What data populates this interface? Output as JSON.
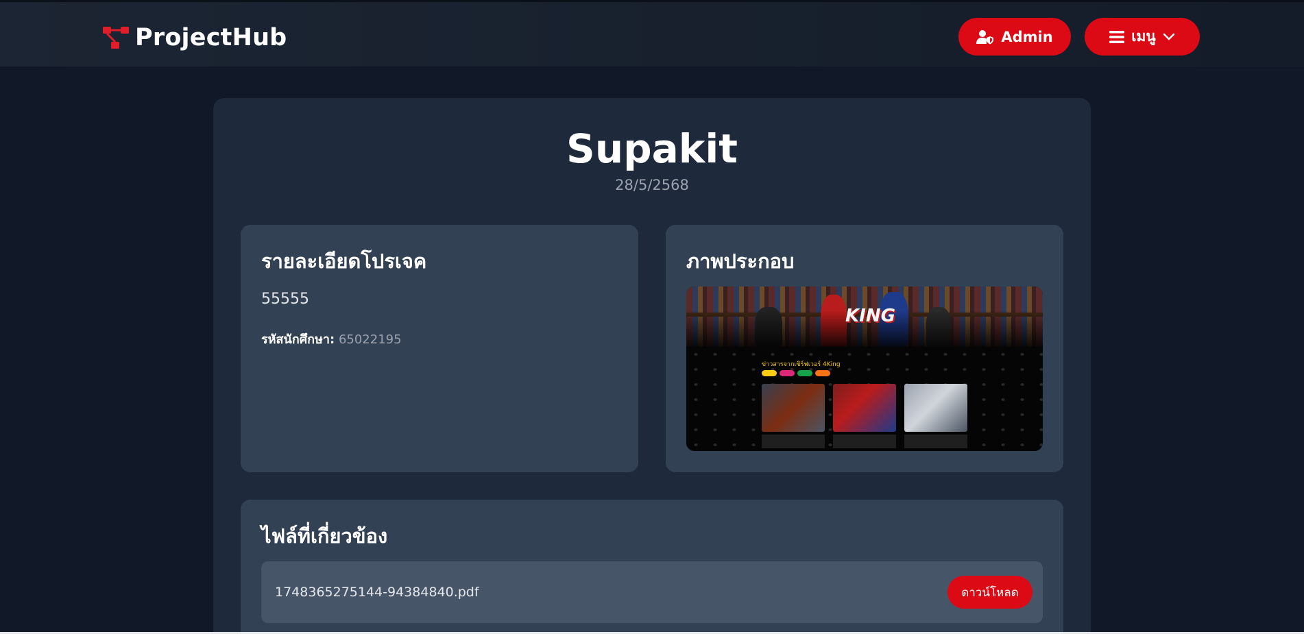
{
  "header": {
    "brand": "ProjectHub",
    "admin_label": "Admin",
    "menu_label": "เมนู",
    "brand_icon": "project-diagram-icon",
    "accent": "#dc0a14"
  },
  "project": {
    "title": "Supakit",
    "date": "28/5/2568",
    "details_heading": "รายละเอียดโปรเจค",
    "details_text": "55555",
    "student_id_label": "รหัสนักศึกษา:",
    "student_id_value": "65022195",
    "image_heading": "ภาพประกอบ",
    "image_logo_text": "KING",
    "image_caption": "ข่าวสารจากเซิร์ฟเวอร์ 4King"
  },
  "files": {
    "heading": "ไฟล์ที่เกี่ยวข้อง",
    "items": [
      {
        "name": "1748365275144-94384840.pdf",
        "action_label": "ดาวน์โหลด"
      }
    ]
  }
}
